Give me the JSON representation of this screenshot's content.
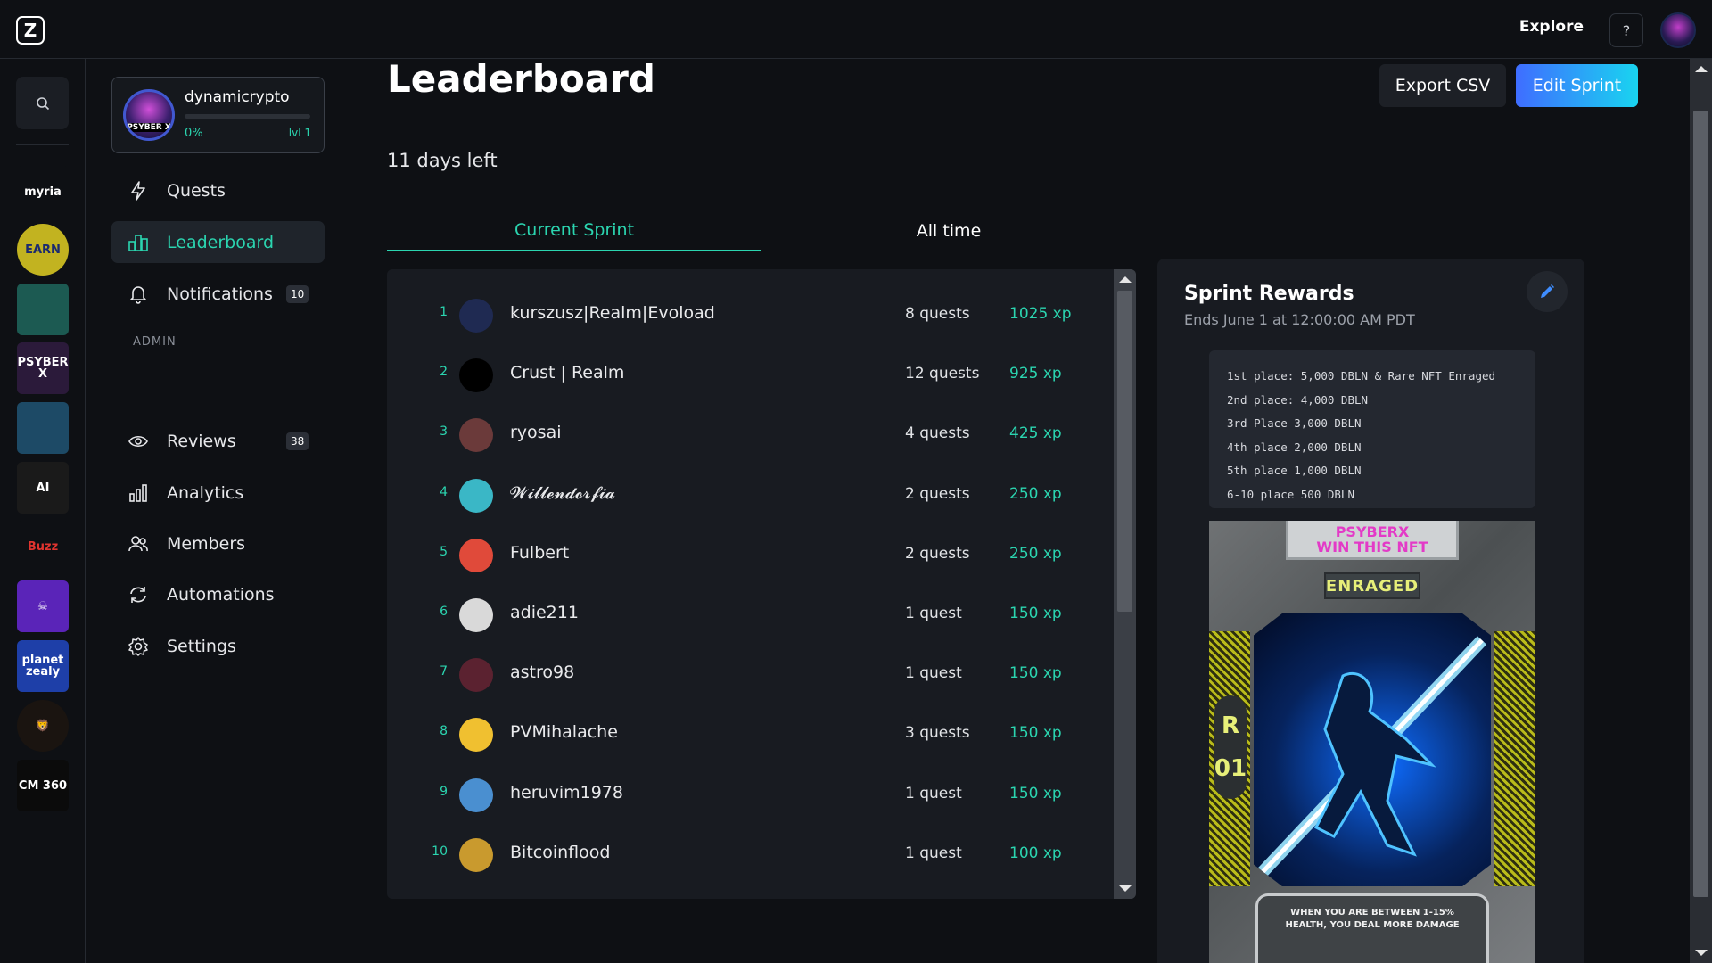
{
  "topbar": {
    "logo": "Z",
    "explore": "Explore",
    "help": "?"
  },
  "rail": {
    "items": [
      {
        "name": "myria",
        "label": "myria",
        "bg": "#0e1014",
        "fg": "#ffffff"
      },
      {
        "name": "earn",
        "label": "EARN",
        "bg": "#c2b320",
        "fg": "#1b2a6f"
      },
      {
        "name": "glitch",
        "label": "",
        "bg": "#1c5a52",
        "fg": "#ffffff"
      },
      {
        "name": "psyberx",
        "label": "PSYBER X",
        "bg": "#2b1a3a",
        "fg": "#ffffff"
      },
      {
        "name": "cyber-city",
        "label": "",
        "bg": "#1d4a66",
        "fg": "#ffffff"
      },
      {
        "name": "ai",
        "label": "AI",
        "bg": "#1a1a1a",
        "fg": "#ffffff"
      },
      {
        "name": "buzz",
        "label": "Buzz",
        "bg": "#0e1014",
        "fg": "#e0342f"
      },
      {
        "name": "skull",
        "label": "☠",
        "bg": "#5a24b8",
        "fg": "#ffffff"
      },
      {
        "name": "planet-zealy",
        "label": "planet zealy",
        "bg": "#1e3fa8",
        "fg": "#ffffff"
      },
      {
        "name": "lion",
        "label": "🦁",
        "bg": "#1a1410",
        "fg": "#ffb000"
      },
      {
        "name": "cm360",
        "label": "CM 360",
        "bg": "#0b0b0b",
        "fg": "#ffffff"
      }
    ]
  },
  "profile": {
    "name": "dynamicrypto",
    "avatar_text": "PSYBER X",
    "progress_percent": 0,
    "progress_label": "0%",
    "level": "lvl 1"
  },
  "nav": {
    "quests": "Quests",
    "leaderboard": "Leaderboard",
    "notifications": "Notifications",
    "notifications_count": "10",
    "admin_label": "ADMIN",
    "reviews": "Reviews",
    "reviews_count": "38",
    "analytics": "Analytics",
    "members": "Members",
    "automations": "Automations",
    "settings": "Settings"
  },
  "main": {
    "title": "Leaderboard",
    "export_csv": "Export CSV",
    "edit_sprint": "Edit Sprint",
    "days_left": "11 days left",
    "tabs": [
      "Current Sprint",
      "All time"
    ]
  },
  "leaderboard": {
    "rows": [
      {
        "rank": "1",
        "name": "kurszusz|Realm|Evoload",
        "quests": "8 quests",
        "xp": "1025 xp",
        "avatar": "#1f2a52"
      },
      {
        "rank": "2",
        "name": "Crust | Realm",
        "quests": "12 quests",
        "xp": "925 xp",
        "avatar": "#000000"
      },
      {
        "rank": "3",
        "name": "ryosai",
        "quests": "4 quests",
        "xp": "425 xp",
        "avatar": "#6b3a3a"
      },
      {
        "rank": "4",
        "name": "𝓦𝓲𝓵𝓵𝓮𝓷𝓭𝓸𝓻𝓯𝓲𝓪",
        "quests": "2 quests",
        "xp": "250 xp",
        "avatar": "#3ab7c6"
      },
      {
        "rank": "5",
        "name": "Fulbert",
        "quests": "2 quests",
        "xp": "250 xp",
        "avatar": "#e04a3a"
      },
      {
        "rank": "6",
        "name": "adie211",
        "quests": "1 quest",
        "xp": "150 xp",
        "avatar": "#d9d9d9"
      },
      {
        "rank": "7",
        "name": "astro98",
        "quests": "1 quest",
        "xp": "150 xp",
        "avatar": "#5b2230"
      },
      {
        "rank": "8",
        "name": "PVMihalache",
        "quests": "3 quests",
        "xp": "150 xp",
        "avatar": "#f0c030"
      },
      {
        "rank": "9",
        "name": "heruvim1978",
        "quests": "1 quest",
        "xp": "150 xp",
        "avatar": "#4a8fd0"
      },
      {
        "rank": "10",
        "name": "Bitcoinflood",
        "quests": "1 quest",
        "xp": "100 xp",
        "avatar": "#c99a2e"
      }
    ]
  },
  "rewards": {
    "title": "Sprint Rewards",
    "ends": "Ends June 1 at 12:00:00 AM PDT",
    "lines": [
      "1st place: 5,000 DBLN & Rare NFT Enraged",
      "2nd place: 4,000 DBLN",
      "3rd Place 3,000 DBLN",
      "4th place 2,000 DBLN",
      "5th place 1,000 DBLN",
      "6-10 place 500 DBLN"
    ],
    "nft": {
      "banner_1": "PSYBERX",
      "banner_2": "WIN THIS NFT",
      "badge": "ENRAGED",
      "rarity_1": "R",
      "rarity_2": "01",
      "caption": "WHEN YOU ARE BETWEEN 1-15% HEALTH, YOU DEAL MORE DAMAGE"
    }
  },
  "colors": {
    "accent": "#2bd5b0",
    "background": "#0e1014",
    "panel": "#181b21"
  }
}
